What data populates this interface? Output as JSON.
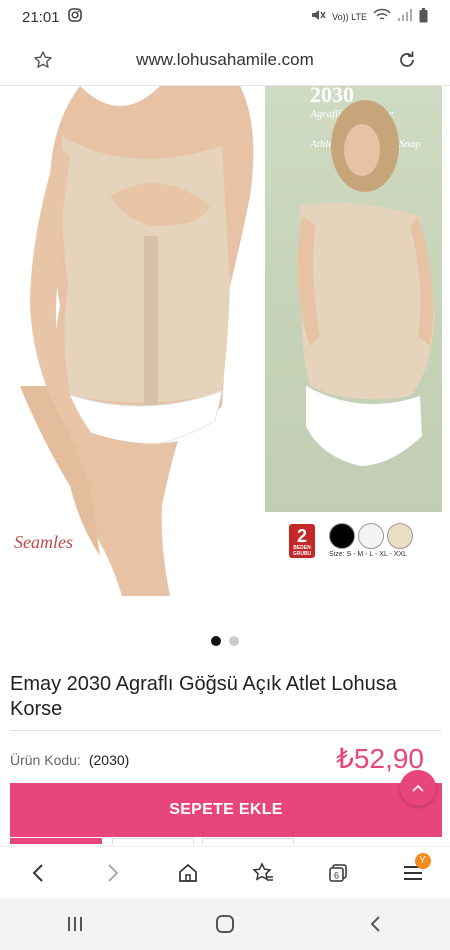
{
  "status_bar": {
    "time": "21:01",
    "camera_icon": "instagram-icon",
    "signal_text": "Vo)) LTE"
  },
  "browser": {
    "url": "www.lohusahamile.com",
    "star_icon": "star-outline-icon",
    "reload_icon": "reload-icon"
  },
  "product_image": {
    "model_code": "2030",
    "caption_tr": "Agrafli Atlet Korse",
    "caption_en": "Athlete Corset With Snap",
    "seamless_label": "Seamles",
    "badge_number": "2",
    "badge_text": "BEDEN GRUBU",
    "sizes": "Size: S - M - L - XL - XXL",
    "swatch_colors": [
      "#000000",
      "#f4f4f0",
      "#e8dfc4"
    ]
  },
  "carousel": {
    "active_index": 0,
    "count": 2
  },
  "product": {
    "title": "Emay 2030 Agraflı Göğsü Açık Atlet Lohusa Korse",
    "code_label": "Ürün Kodu:",
    "code_value": "(2030)",
    "price": "₺52,90"
  },
  "actions": {
    "add_to_cart": "SEPETE EKLE"
  },
  "browser_bottom": {
    "tabs_count": "6",
    "menu_badge": "Y"
  },
  "colors": {
    "accent": "#e8457a",
    "badge": "#f58a1f"
  }
}
